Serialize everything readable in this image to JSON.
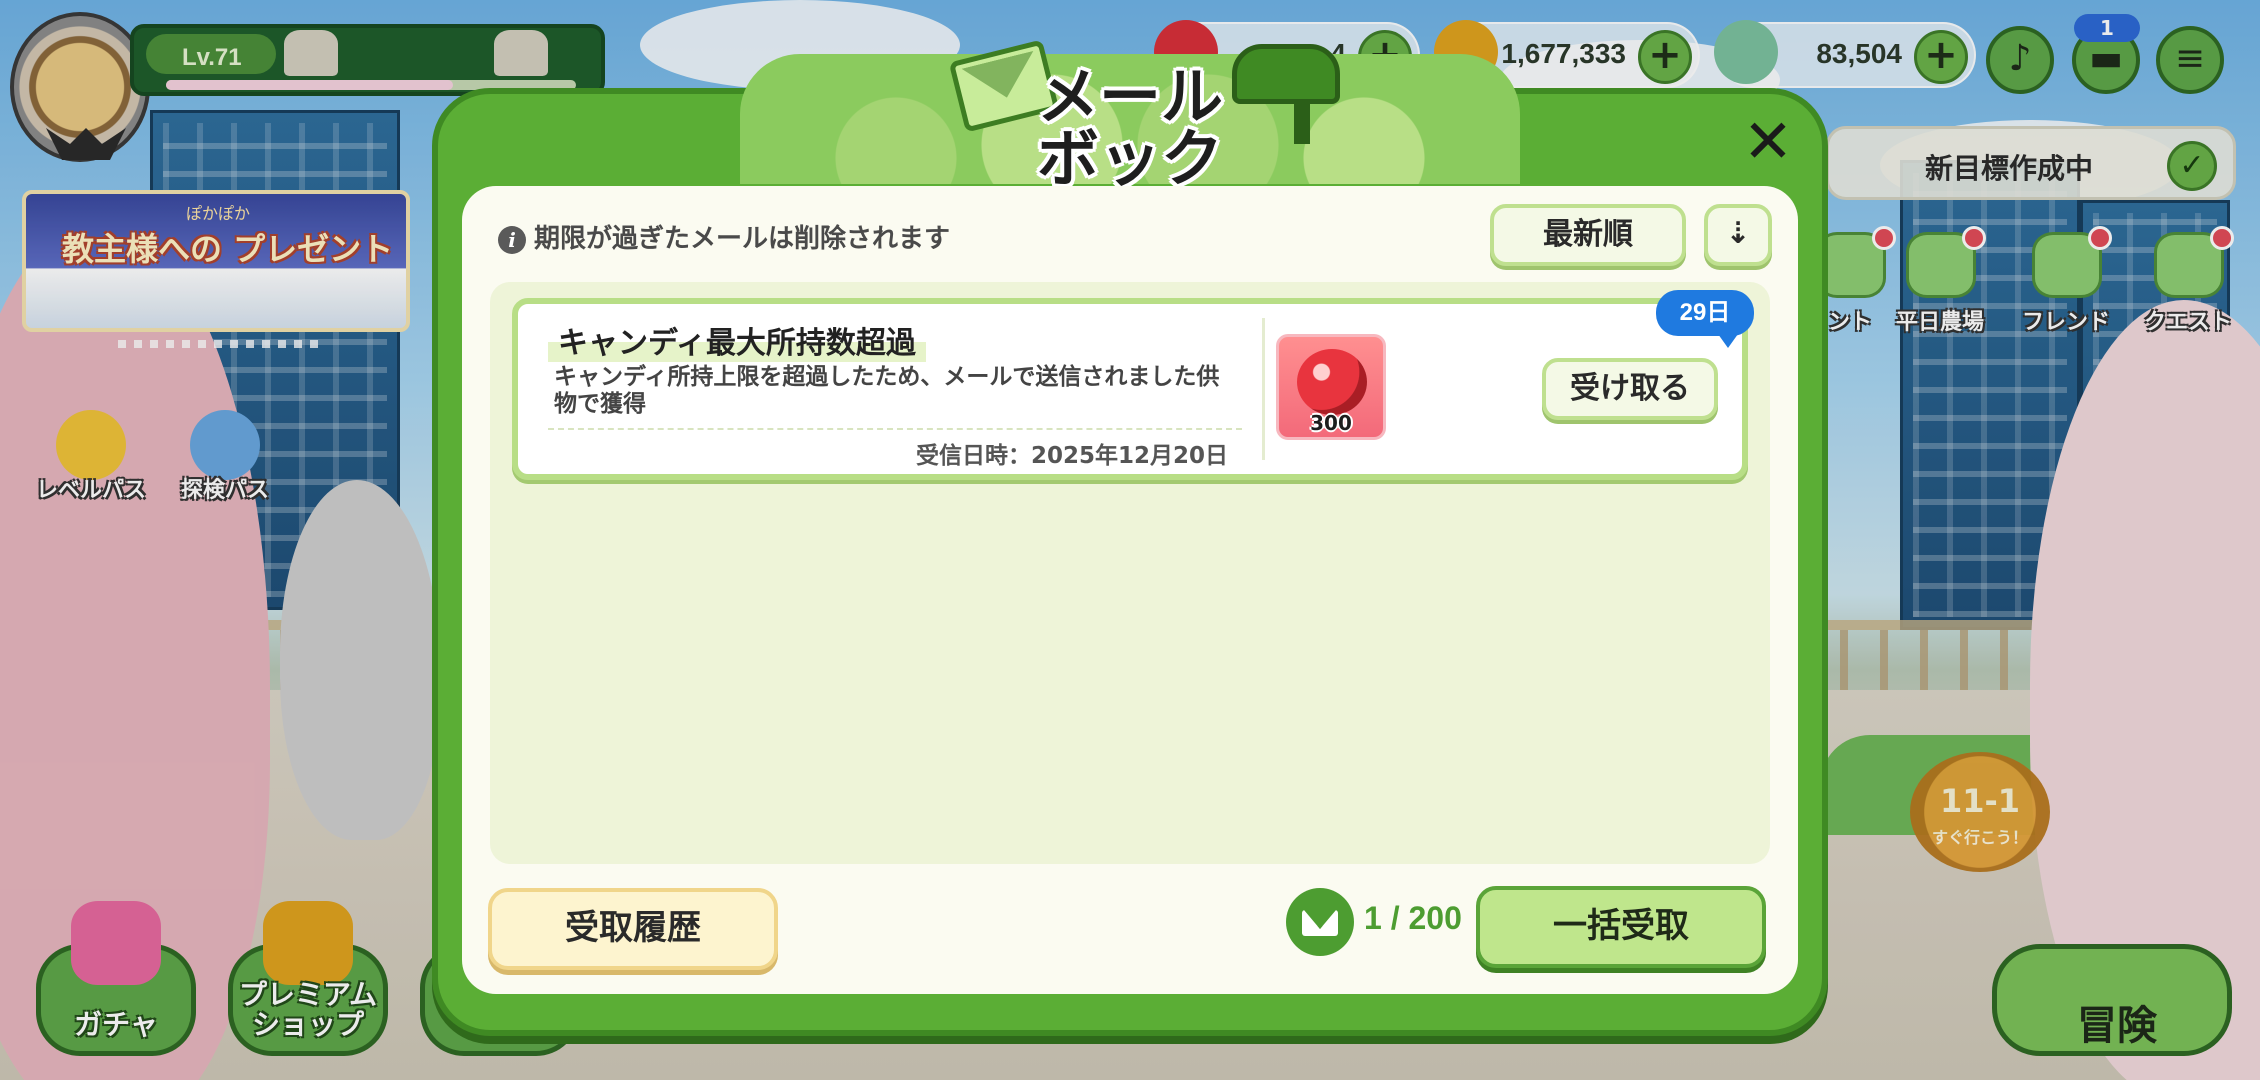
{
  "hud": {
    "level": "Lv.71",
    "currencies": [
      {
        "name": "candy",
        "value": "4",
        "color": "#d8303a"
      },
      {
        "name": "coin",
        "value": "1,677,333",
        "color": "#e0a31f"
      },
      {
        "name": "crystal",
        "value": "83,504",
        "color": "#7cc2a0"
      }
    ],
    "notification_count": "1"
  },
  "left_panel": {
    "event_banner_title": "教主様への プレゼント",
    "event_banner_sub": "ぽかぽか",
    "level_pass_label": "レベルパス",
    "explore_pass_label": "探検パス"
  },
  "right_panel": {
    "goal_text": "新目標作成中",
    "nav": [
      {
        "label": "ント"
      },
      {
        "label": "平日農場"
      },
      {
        "label": "フレンド"
      },
      {
        "label": "クエスト"
      }
    ],
    "stage_number": "11-1",
    "stage_sub": "すぐ行こう！"
  },
  "bottom_nav": {
    "gacha": "ガチャ",
    "premium_shop_line1": "プレミアム",
    "premium_shop_line2": "ショップ",
    "adventure": "冒険"
  },
  "modal": {
    "title_line1": "メール",
    "title_line2": "ボックス",
    "close_symbol": "✕",
    "notice": "期限が過ぎたメールは削除されます",
    "info_symbol": "i",
    "sort_label": "最新順",
    "sort_direction_symbol": "⇣",
    "mails": [
      {
        "title": "キャンディ最大所持数超過",
        "body": "キャンディ所持上限を超過したため、メールで送信されました供物で獲得",
        "received": "受信日時：2025年12月20日",
        "reward_qty": "300",
        "claim_label": "受け取る",
        "expires": "29日"
      }
    ],
    "history_label": "受取履歴",
    "mail_count": "1 / 200",
    "bulk_claim_label": "一括受取"
  },
  "colors": {
    "modal_green": "#5bae35",
    "panel_bg": "#fbfbf1",
    "days_badge": "#1f7ae0",
    "history_button": "#fdf4cf",
    "bulk_button": "#bfe68c"
  }
}
